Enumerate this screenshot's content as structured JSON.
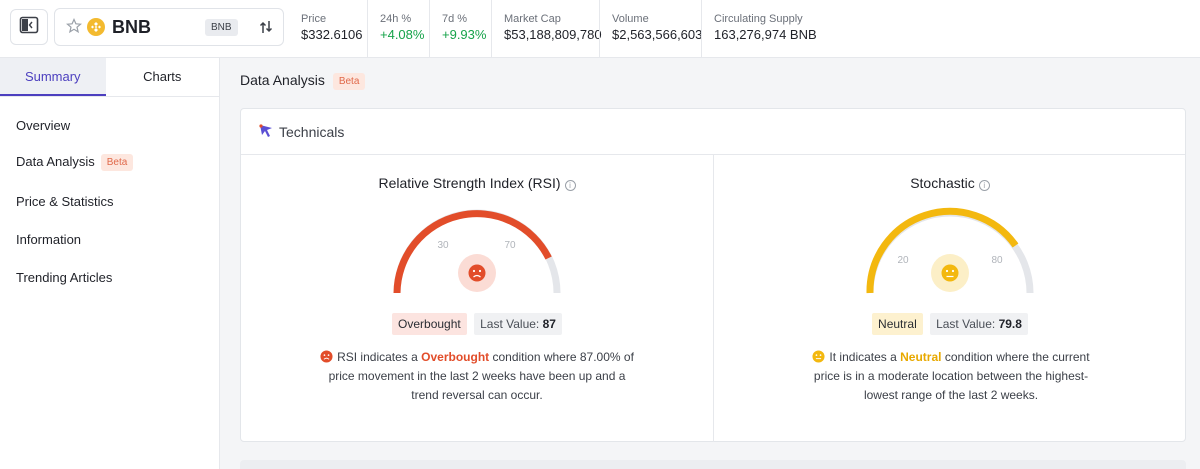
{
  "header": {
    "asset_name": "BNB",
    "ticker": "BNB",
    "stats": [
      {
        "label": "Price",
        "value": "$332.6106",
        "trend": "neutral"
      },
      {
        "label": "24h %",
        "value": "+4.08%",
        "trend": "up"
      },
      {
        "label": "7d %",
        "value": "+9.93%",
        "trend": "up"
      },
      {
        "label": "Market Cap",
        "value": "$53,188,809,780",
        "trend": "neutral"
      },
      {
        "label": "Volume",
        "value": "$2,563,566,603",
        "trend": "neutral"
      },
      {
        "label": "Circulating Supply",
        "value": "163,276,974 BNB",
        "trend": "neutral"
      }
    ]
  },
  "sidebar": {
    "tabs": [
      {
        "label": "Summary",
        "active": true
      },
      {
        "label": "Charts",
        "active": false
      }
    ],
    "items": [
      {
        "label": "Overview"
      },
      {
        "label": "Data Analysis",
        "badge": "Beta"
      },
      {
        "label": "Price & Statistics"
      },
      {
        "label": "Information"
      },
      {
        "label": "Trending Articles"
      }
    ]
  },
  "main": {
    "section_title": "Data Analysis",
    "section_badge": "Beta",
    "card_title": "Technicals",
    "rsi": {
      "title": "Relative Strength Index (RSI)",
      "scale_low": "30",
      "scale_high": "70",
      "status": "Overbought",
      "last_value_label": "Last Value:",
      "last_value": "87",
      "desc_pre": "RSI indicates a ",
      "desc_keyword": "Overbought",
      "desc_post": " condition where 87.00% of price movement in the last 2 weeks have been up and a trend reversal can occur."
    },
    "stochastic": {
      "title": "Stochastic",
      "scale_low": "20",
      "scale_high": "80",
      "status": "Neutral",
      "last_value_label": "Last Value:",
      "last_value": "79.8",
      "desc_pre": "It indicates a ",
      "desc_keyword": "Neutral",
      "desc_post": " condition where the current price is in a moderate location between the highest-lowest range of the last 2 weeks."
    }
  },
  "colors": {
    "accent": "#4c3fbf",
    "overbought": "#e24d2a",
    "neutral": "#f3b80f",
    "positive": "#16a34a",
    "coin": "#f3ba2f"
  },
  "icons": [
    "sidebar-toggle-icon",
    "star-icon",
    "bnb-coin-icon",
    "swap-icon",
    "technicals-icon",
    "info-icon",
    "sad-face-icon",
    "neutral-face-icon"
  ]
}
